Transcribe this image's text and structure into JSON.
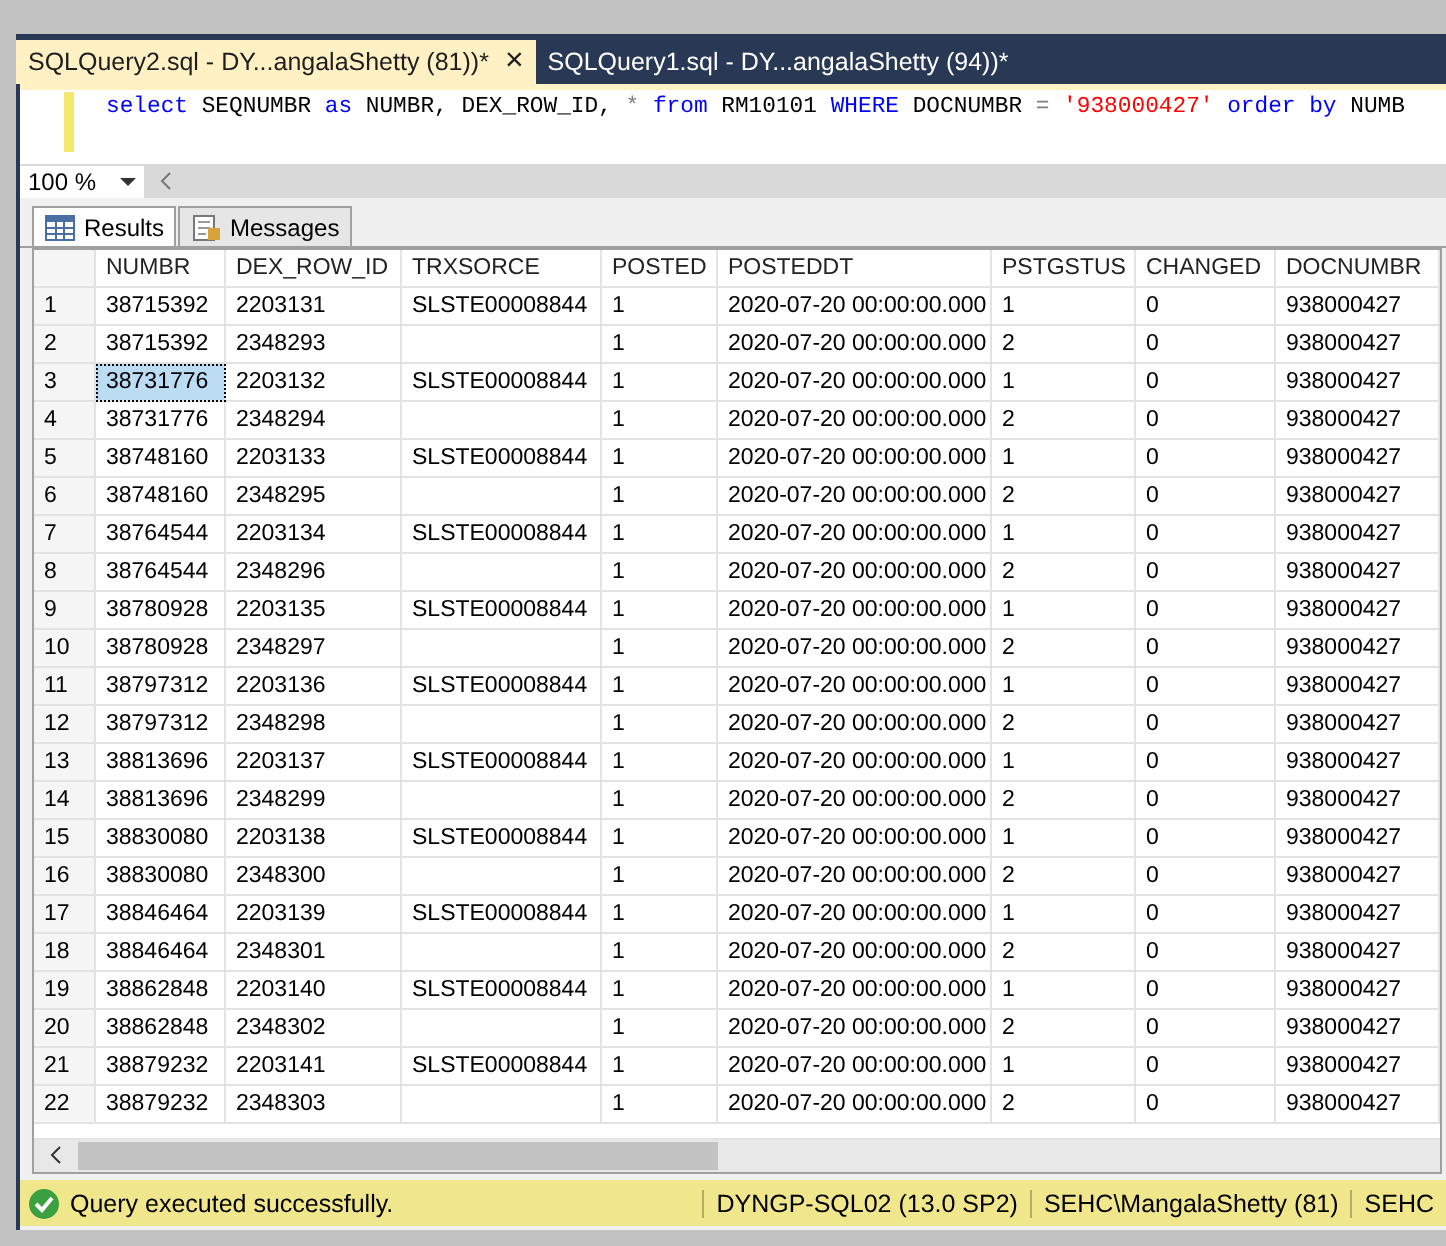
{
  "doc_tabs": [
    {
      "label": "SQLQuery2.sql - DY...angalaShetty (81))*",
      "selected": true,
      "close": "×"
    },
    {
      "label": "SQLQuery1.sql - DY...angalaShetty (94))*",
      "selected": false
    }
  ],
  "query": [
    {
      "kind": "keyword",
      "text": "select"
    },
    {
      "kind": "plain",
      "text": " SEQNUMBR "
    },
    {
      "kind": "keyword",
      "text": "as"
    },
    {
      "kind": "plain",
      "text": " NUMBR, DEX_ROW_ID, "
    },
    {
      "kind": "operator",
      "text": "*"
    },
    {
      "kind": "keyword",
      "text": " from"
    },
    {
      "kind": "plain",
      "text": " RM10101 "
    },
    {
      "kind": "keyword",
      "text": "WHERE"
    },
    {
      "kind": "plain",
      "text": " DOCNUMBR "
    },
    {
      "kind": "operator",
      "text": "="
    },
    {
      "kind": "string",
      "text": " '938000427'"
    },
    {
      "kind": "keyword",
      "text": " order by"
    },
    {
      "kind": "plain",
      "text": " NUMB"
    }
  ],
  "zoom": "100 %",
  "result_tabs": [
    {
      "label": "Results",
      "selected": true
    },
    {
      "label": "Messages",
      "selected": false
    }
  ],
  "table": {
    "columns": [
      "NUMBR",
      "DEX_ROW_ID",
      "TRXSORCE",
      "POSTED",
      "POSTEDDT",
      "PSTGSTUS",
      "CHANGED",
      "DOCNUMBR"
    ],
    "rows": [
      {
        "n": "1",
        "cells": [
          "38715392",
          "2203131",
          "SLSTE00008844",
          "1",
          "2020-07-20 00:00:00.000",
          "1",
          "0",
          "938000427"
        ],
        "selected": false
      },
      {
        "n": "2",
        "cells": [
          "38715392",
          "2348293",
          null,
          "1",
          "2020-07-20 00:00:00.000",
          "2",
          "0",
          "938000427"
        ],
        "selected": false
      },
      {
        "n": "3",
        "cells": [
          "38731776",
          "2203132",
          "SLSTE00008844",
          "1",
          "2020-07-20 00:00:00.000",
          "1",
          "0",
          "938000427"
        ],
        "selected": true
      },
      {
        "n": "4",
        "cells": [
          "38731776",
          "2348294",
          null,
          "1",
          "2020-07-20 00:00:00.000",
          "2",
          "0",
          "938000427"
        ],
        "selected": false
      },
      {
        "n": "5",
        "cells": [
          "38748160",
          "2203133",
          "SLSTE00008844",
          "1",
          "2020-07-20 00:00:00.000",
          "1",
          "0",
          "938000427"
        ],
        "selected": false
      },
      {
        "n": "6",
        "cells": [
          "38748160",
          "2348295",
          null,
          "1",
          "2020-07-20 00:00:00.000",
          "2",
          "0",
          "938000427"
        ],
        "selected": false
      },
      {
        "n": "7",
        "cells": [
          "38764544",
          "2203134",
          "SLSTE00008844",
          "1",
          "2020-07-20 00:00:00.000",
          "1",
          "0",
          "938000427"
        ],
        "selected": false
      },
      {
        "n": "8",
        "cells": [
          "38764544",
          "2348296",
          null,
          "1",
          "2020-07-20 00:00:00.000",
          "2",
          "0",
          "938000427"
        ],
        "selected": false
      },
      {
        "n": "9",
        "cells": [
          "38780928",
          "2203135",
          "SLSTE00008844",
          "1",
          "2020-07-20 00:00:00.000",
          "1",
          "0",
          "938000427"
        ],
        "selected": false
      },
      {
        "n": "10",
        "cells": [
          "38780928",
          "2348297",
          null,
          "1",
          "2020-07-20 00:00:00.000",
          "2",
          "0",
          "938000427"
        ],
        "selected": false
      },
      {
        "n": "11",
        "cells": [
          "38797312",
          "2203136",
          "SLSTE00008844",
          "1",
          "2020-07-20 00:00:00.000",
          "1",
          "0",
          "938000427"
        ],
        "selected": false
      },
      {
        "n": "12",
        "cells": [
          "38797312",
          "2348298",
          null,
          "1",
          "2020-07-20 00:00:00.000",
          "2",
          "0",
          "938000427"
        ],
        "selected": false
      },
      {
        "n": "13",
        "cells": [
          "38813696",
          "2203137",
          "SLSTE00008844",
          "1",
          "2020-07-20 00:00:00.000",
          "1",
          "0",
          "938000427"
        ],
        "selected": false
      },
      {
        "n": "14",
        "cells": [
          "38813696",
          "2348299",
          null,
          "1",
          "2020-07-20 00:00:00.000",
          "2",
          "0",
          "938000427"
        ],
        "selected": false
      },
      {
        "n": "15",
        "cells": [
          "38830080",
          "2203138",
          "SLSTE00008844",
          "1",
          "2020-07-20 00:00:00.000",
          "1",
          "0",
          "938000427"
        ],
        "selected": false
      },
      {
        "n": "16",
        "cells": [
          "38830080",
          "2348300",
          null,
          "1",
          "2020-07-20 00:00:00.000",
          "2",
          "0",
          "938000427"
        ],
        "selected": false
      },
      {
        "n": "17",
        "cells": [
          "38846464",
          "2203139",
          "SLSTE00008844",
          "1",
          "2020-07-20 00:00:00.000",
          "1",
          "0",
          "938000427"
        ],
        "selected": false
      },
      {
        "n": "18",
        "cells": [
          "38846464",
          "2348301",
          null,
          "1",
          "2020-07-20 00:00:00.000",
          "2",
          "0",
          "938000427"
        ],
        "selected": false
      },
      {
        "n": "19",
        "cells": [
          "38862848",
          "2203140",
          "SLSTE00008844",
          "1",
          "2020-07-20 00:00:00.000",
          "1",
          "0",
          "938000427"
        ],
        "selected": false
      },
      {
        "n": "20",
        "cells": [
          "38862848",
          "2348302",
          null,
          "1",
          "2020-07-20 00:00:00.000",
          "2",
          "0",
          "938000427"
        ],
        "selected": false
      },
      {
        "n": "21",
        "cells": [
          "38879232",
          "2203141",
          "SLSTE00008844",
          "1",
          "2020-07-20 00:00:00.000",
          "1",
          "0",
          "938000427"
        ],
        "selected": false
      },
      {
        "n": "22",
        "cells": [
          "38879232",
          "2348303",
          null,
          "1",
          "2020-07-20 00:00:00.000",
          "2",
          "0",
          "938000427"
        ],
        "selected": false
      }
    ]
  },
  "status_bar": {
    "message": "Query executed successfully.",
    "server": "DYNGP-SQL02 (13.0 SP2)",
    "user": "SEHC\\MangalaShetty (81)",
    "extra": "SEHC"
  }
}
